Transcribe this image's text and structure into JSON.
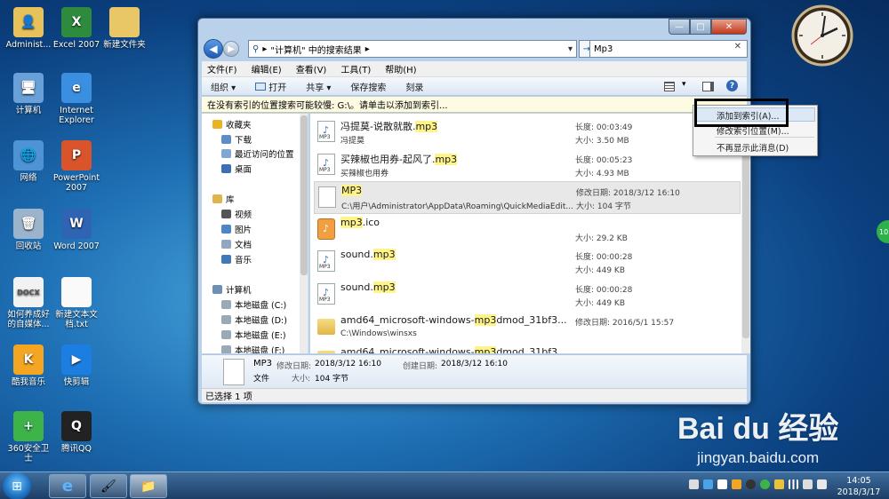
{
  "desktop": {
    "icons": [
      {
        "label": "Administ...",
        "color": "#e7c15a",
        "glyph": "👤"
      },
      {
        "label": "Excel 2007",
        "color": "#2e8b3e",
        "glyph": "X"
      },
      {
        "label": "新建文件夹",
        "color": "#e9c766",
        "glyph": ""
      },
      {
        "label": "计算机",
        "color": "#6aa0d8",
        "glyph": "🖥"
      },
      {
        "label": "Internet Explorer",
        "color": "#3a8fe0",
        "glyph": "e"
      },
      {
        "label": "网络",
        "color": "#4e94d4",
        "glyph": "🌐"
      },
      {
        "label": "PowerPoint 2007",
        "color": "#d9542b",
        "glyph": "P"
      },
      {
        "label": "回收站",
        "color": "#9bb4cc",
        "glyph": "🗑"
      },
      {
        "label": "Word 2007",
        "color": "#2f64b4",
        "glyph": "W"
      },
      {
        "label": "如何养成好的自媒体...",
        "color": "#f2f2f2",
        "glyph": "DOCX"
      },
      {
        "label": "新建文本文档.txt",
        "color": "#fafafa",
        "glyph": ""
      },
      {
        "label": "酷我音乐",
        "color": "#f4a623",
        "glyph": "K"
      },
      {
        "label": "快剪辑",
        "color": "#1c7ee0",
        "glyph": "▶"
      },
      {
        "label": "360安全卫士",
        "color": "#3db34a",
        "glyph": "+"
      },
      {
        "label": "腾讯QQ",
        "color": "#222",
        "glyph": "Q"
      }
    ],
    "watermark_logo": "Bai du 经验",
    "watermark_url": "jingyan.baidu.com",
    "green_badge": "10"
  },
  "window": {
    "controls": {
      "minimize": "—",
      "maximize": "□",
      "close": "✕"
    },
    "address": {
      "prefix": "▸",
      "text": "\"计算机\" 中的搜索结果",
      "arrow": "▸"
    },
    "search_value": "Mp3",
    "search_clear": "✕",
    "menu": [
      "文件(F)",
      "编辑(E)",
      "查看(V)",
      "工具(T)",
      "帮助(H)"
    ],
    "toolbar": {
      "organize": "组织 ▾",
      "open": "打开",
      "share": "共享 ▾",
      "save_search": "保存搜索",
      "burn": "刻录"
    },
    "infobar": "在没有索引的位置搜索可能较慢: G:\\。请单击以添加到索引...",
    "nav_tree": [
      {
        "label": "收藏夹",
        "icon": "star-icon",
        "color": "#e9b321",
        "level": 0
      },
      {
        "label": "下载",
        "icon": "download-folder-icon",
        "color": "#5b8ec8",
        "level": 1
      },
      {
        "label": "最近访问的位置",
        "icon": "recent-places-icon",
        "color": "#7ea7d4",
        "level": 1
      },
      {
        "label": "桌面",
        "icon": "desktop-icon",
        "color": "#3c6fb5",
        "level": 1
      },
      {
        "label": "库",
        "icon": "library-icon",
        "color": "#e0b54a",
        "level": 0
      },
      {
        "label": "视频",
        "icon": "video-icon",
        "color": "#555",
        "level": 1
      },
      {
        "label": "图片",
        "icon": "picture-icon",
        "color": "#4c86c7",
        "level": 1
      },
      {
        "label": "文档",
        "icon": "document-icon",
        "color": "#8fa7c0",
        "level": 1
      },
      {
        "label": "音乐",
        "icon": "music-icon",
        "color": "#4078b8",
        "level": 1
      },
      {
        "label": "计算机",
        "icon": "computer-icon",
        "color": "#6c8fb4",
        "level": 0
      },
      {
        "label": "本地磁盘 (C:)",
        "icon": "drive-icon",
        "color": "#9aa9b8",
        "level": 1
      },
      {
        "label": "本地磁盘 (D:)",
        "icon": "drive-icon",
        "color": "#9aa9b8",
        "level": 1
      },
      {
        "label": "本地磁盘 (E:)",
        "icon": "drive-icon",
        "color": "#9aa9b8",
        "level": 1
      },
      {
        "label": "本地磁盘 (F:)",
        "icon": "drive-icon",
        "color": "#9aa9b8",
        "level": 1
      }
    ],
    "results": [
      {
        "name_pre": "冯提莫-说散就散.",
        "name_hl": "mp3",
        "name_post": "",
        "sub": "冯提莫",
        "m1": "长度: 00:03:49",
        "m2": "大小: 3.50 MB",
        "type": "mp3",
        "selected": false
      },
      {
        "name_pre": "买辣椒也用券-起风了.",
        "name_hl": "mp3",
        "name_post": "",
        "sub": "买辣椒也用券",
        "m1": "长度: 00:05:23",
        "m2": "大小: 4.93 MB",
        "type": "mp3",
        "selected": false
      },
      {
        "name_pre": "",
        "name_hl": "MP3",
        "name_post": "",
        "sub": "C:\\用户\\Administrator\\AppData\\Roaming\\QuickMediaEdit...",
        "m1": "修改日期: 2018/3/12 16:10",
        "m2": "大小: 104 字节",
        "type": "blank",
        "selected": true
      },
      {
        "name_pre": "",
        "name_hl": "mp3",
        "name_post": ".ico",
        "sub": "",
        "m1": "",
        "m2": "大小: 29.2 KB",
        "type": "ico",
        "selected": false
      },
      {
        "name_pre": "sound.",
        "name_hl": "mp3",
        "name_post": "",
        "sub": "",
        "m1": "长度: 00:00:28",
        "m2": "大小: 449 KB",
        "type": "mp3",
        "selected": false
      },
      {
        "name_pre": "sound.",
        "name_hl": "mp3",
        "name_post": "",
        "sub": "",
        "m1": "长度: 00:00:28",
        "m2": "大小: 449 KB",
        "type": "mp3",
        "selected": false
      },
      {
        "name_pre": "amd64_microsoft-windows-",
        "name_hl": "mp3",
        "name_post": "dmod_31bf3...",
        "sub": "C:\\Windows\\winsxs",
        "m1": "修改日期: 2016/5/1 15:57",
        "m2": "",
        "type": "folder",
        "selected": false
      },
      {
        "name_pre": "amd64_microsoft-windows-",
        "name_hl": "mp3",
        "name_post": "dmod_31bf3...",
        "sub": "",
        "m1": "",
        "m2": "",
        "type": "folder",
        "selected": false
      }
    ],
    "details": {
      "name": "MP3",
      "modified_label": "修改日期:",
      "modified": "2018/3/12 16:10",
      "created_label": "创建日期:",
      "created": "2018/3/12 16:10",
      "type": "文件",
      "size_label": "大小:",
      "size": "104 字节"
    },
    "status": "已选择 1 项"
  },
  "context_menu": [
    "添加到索引(A)...",
    "修改索引位置(M)...",
    "不再显示此消息(D)"
  ],
  "taskbar": {
    "start": "⊞",
    "ie": "e",
    "paint": "🖌",
    "explorer": "📁",
    "time": "14:05",
    "date": "2018/3/17"
  },
  "colors": {
    "highlight": "#fff48a",
    "infobar": "#fdfbe1",
    "window_frame": "#b9d1ea"
  }
}
